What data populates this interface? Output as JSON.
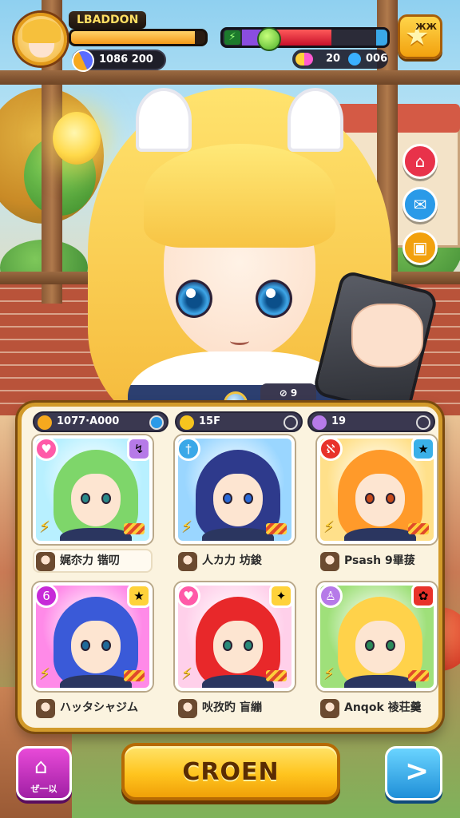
{
  "hud": {
    "player_name": "LBADDON",
    "xp_progress": 0.92,
    "gold": "1086 200",
    "energy_progress": 0.6,
    "gem_count_a": "20",
    "gem_count_b": "006",
    "star_label": "ЖЖ"
  },
  "panel": {
    "resource_1": "1077·A000",
    "resource_2": "15F",
    "resource_3": "19",
    "tab_label": "⊘ 9"
  },
  "characters": [
    {
      "name": "娓夵力 锴叨",
      "hair": "#7ed66a",
      "bg": "#b8f0ff",
      "eye": "#2a8a8a",
      "badge_tl": "♥",
      "badge_tl_color": "#ff5aa8",
      "badge_tr": "↯",
      "badge_tr_color": "#b67ae8"
    },
    {
      "name": "人カ力 坊鋑",
      "hair": "#2e3a8c",
      "bg": "#9ad6ff",
      "eye": "#2a6ad8",
      "badge_tl": "†",
      "badge_tl_color": "#3aa8e8",
      "badge_tr": "",
      "badge_tr_color": "transparent"
    },
    {
      "name": "Psash 9畢菝",
      "hair": "#ff9a2a",
      "bg": "#ffe08a",
      "eye": "#c84a1a",
      "badge_tl": "ℵ",
      "badge_tl_color": "#e8322a",
      "badge_tr": "★",
      "badge_tr_color": "#3ab0e8"
    },
    {
      "name": "ハッタシャジム",
      "hair": "#3a5ad8",
      "bg": "#ff8ae8",
      "eye": "#1f6a9a",
      "badge_tl": "6",
      "badge_tl_color": "#c72ad8",
      "badge_tr": "★",
      "badge_tr_color": "#ffd23a"
    },
    {
      "name": "吙孜旳 盲繃",
      "hair": "#e8282a",
      "bg": "#ffd0ea",
      "eye": "#2a8a7a",
      "badge_tl": "♥",
      "badge_tl_color": "#ff5aa8",
      "badge_tr": "✦",
      "badge_tr_color": "#ffd23a"
    },
    {
      "name": "Anqok 祾荘羹",
      "hair": "#ffd24a",
      "bg": "#9fe07a",
      "eye": "#2a8a5a",
      "badge_tl": "♙",
      "badge_tl_color": "#b67ae8",
      "badge_tr": "✿",
      "badge_tr_color": "#e8322a"
    }
  ],
  "bottom": {
    "home_label": "ぜ一以",
    "main_button": "CROEN"
  },
  "colors": {
    "accent": "#f2a10e",
    "panel_border": "#d29a2a",
    "health_red": "#c7102a"
  },
  "icons": {
    "avatar": "player-avatar",
    "gold": "gold-capsule-icon",
    "energy": "energy-icon",
    "apple": "apple-icon",
    "star": "star-icon",
    "home": "home-icon",
    "next": "chevron-right-icon"
  }
}
